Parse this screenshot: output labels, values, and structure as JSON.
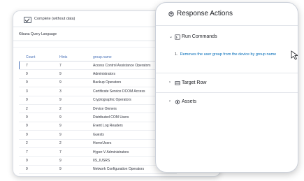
{
  "background": {
    "status_label": "Complete (without data)",
    "query_language": "Kibana Query Language",
    "table": {
      "headers": [
        "Count",
        "Hints",
        "group.name"
      ],
      "rows": [
        [
          "7",
          "7",
          "Access Control Assistance Operators"
        ],
        [
          "9",
          "9",
          "Administrators"
        ],
        [
          "9",
          "9",
          "Backup Operators"
        ],
        [
          "3",
          "3",
          "Certificate Service DCOM Access"
        ],
        [
          "9",
          "9",
          "Cryptographic Operators"
        ],
        [
          "2",
          "2",
          "Device Owners"
        ],
        [
          "9",
          "9",
          "Distributed COM Users"
        ],
        [
          "9",
          "9",
          "Event Log Readers"
        ],
        [
          "9",
          "9",
          "Guests"
        ],
        [
          "2",
          "2",
          "HomeUsers"
        ],
        [
          "7",
          "7",
          "Hyper-V Administrators"
        ],
        [
          "9",
          "9",
          "IIS_IUSRS"
        ],
        [
          "9",
          "9",
          "Network Configuration Operators"
        ]
      ]
    }
  },
  "panel": {
    "title": "Response Actions",
    "sections": {
      "run_commands": {
        "label": "Run Commands",
        "commands": [
          {
            "number": "1.",
            "text": "Removes the user group from the device by group name"
          }
        ]
      },
      "target_row": {
        "label": "Target Row"
      },
      "assets": {
        "label": "Assets"
      }
    }
  },
  "colors": {
    "link": "#006bb8",
    "header_blue": "#4a72b8"
  },
  "icons": {
    "status": "checkbox-check-icon",
    "title": "response-actions-icon",
    "run_commands": "terminal-icon",
    "target_row": "table-row-icon",
    "assets": "asset-icon",
    "cursor": "mouse-pointer-icon"
  }
}
